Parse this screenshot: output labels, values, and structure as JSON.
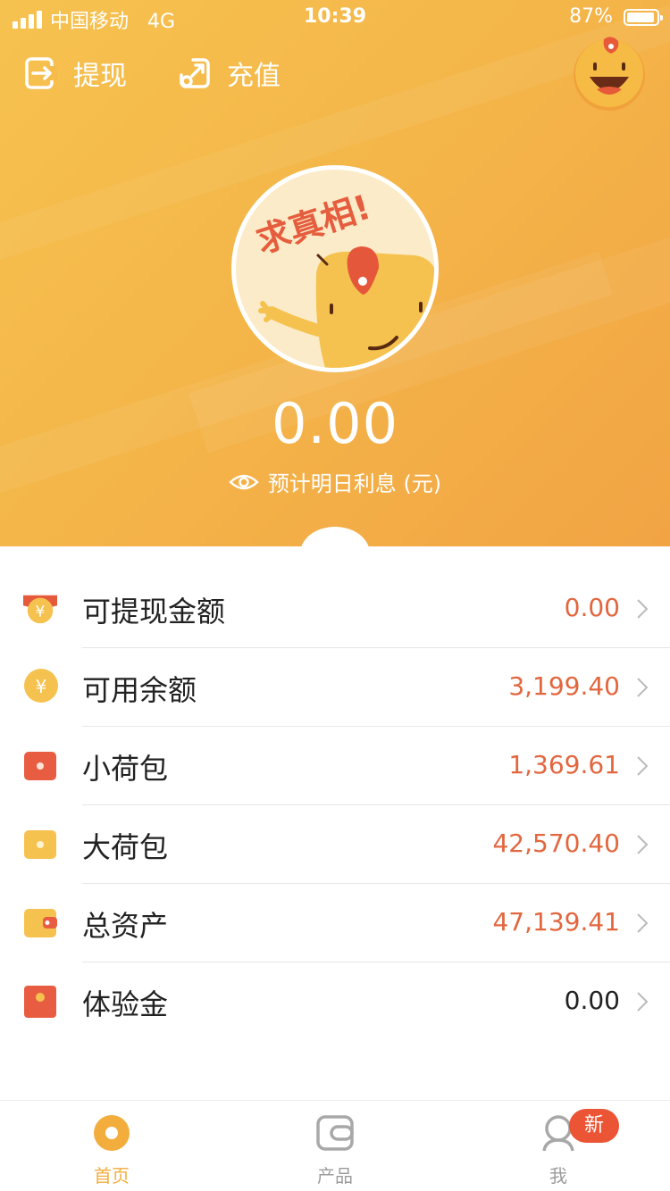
{
  "status_bar": {
    "carrier": "中国移动",
    "network": "4G",
    "time": "10:39",
    "battery_text": "87%",
    "battery_level": 0.87
  },
  "header": {
    "withdraw_label": "提现",
    "recharge_label": "充值",
    "withdraw_icon": "withdraw-icon",
    "recharge_icon": "recharge-icon"
  },
  "hero": {
    "badge_text": "求真相!",
    "amount": "0.00",
    "interest_label": "预计明日利息 (元)"
  },
  "accounts": [
    {
      "label": "可提现金额",
      "value": "0.00",
      "icon": "yen-envelope-icon",
      "value_color": "#e2673f"
    },
    {
      "label": "可用余额",
      "value": "3,199.40",
      "icon": "yen-coin-icon",
      "value_color": "#e2673f"
    },
    {
      "label": "小荷包",
      "value": "1,369.61",
      "icon": "red-purse-icon",
      "value_color": "#e2673f"
    },
    {
      "label": "大荷包",
      "value": "42,570.40",
      "icon": "yellow-purse-icon",
      "value_color": "#e2673f"
    },
    {
      "label": "总资产",
      "value": "47,139.41",
      "icon": "wallet-icon",
      "value_color": "#e2673f"
    },
    {
      "label": "体验金",
      "value": "0.00",
      "icon": "red-packet-icon",
      "value_color": "#222222"
    }
  ],
  "tabbar": {
    "home_label": "首页",
    "products_label": "产品",
    "me_label": "我",
    "me_badge": "新",
    "active_color": "#f3ad3c",
    "inactive_color": "#9c9c9c"
  },
  "colors": {
    "hero_gradient_start": "#f6c24f",
    "hero_gradient_end": "#f2a444",
    "accent_orange": "#e2673f",
    "badge_red": "#ec5436"
  }
}
